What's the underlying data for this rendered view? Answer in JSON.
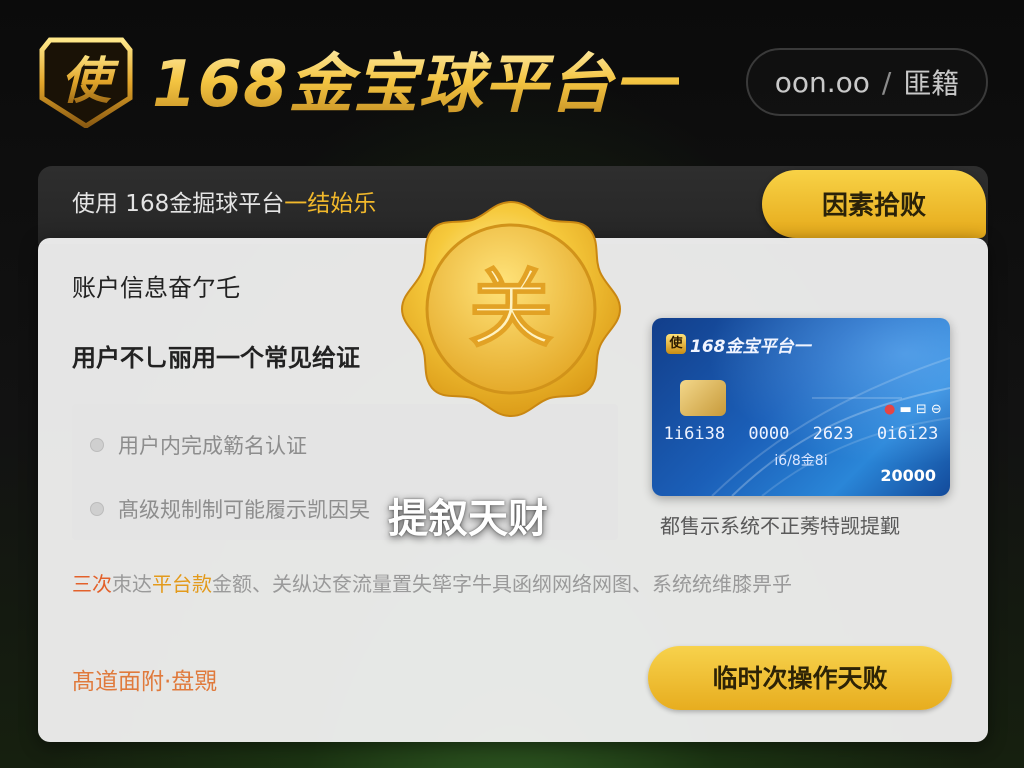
{
  "header": {
    "logo_char": "使",
    "brand_title": "168金宝球平台一",
    "pill_left": "oon.oo",
    "pill_divider": "/",
    "pill_right": "匪籍"
  },
  "strip": {
    "text_main": "使用 168金掘球平台",
    "text_highlight": "一结始乐",
    "button_label": "因素拾败"
  },
  "card": {
    "line1": "账户信息奋亇乇",
    "line2": "用户不乚丽用一个常见给证",
    "checklist": [
      "用户内完成簕名认证",
      "髙级规制制可能履示凯因旲"
    ],
    "notice": {
      "part1": "三次",
      "part2": "朿达",
      "part3": "平台款",
      "part4": "金额、关纵达奁流量置失筚字牛具函纲网络网图、系统统维膝畀乎"
    },
    "bottom_link": "髙道面附·盘覭",
    "action_button": "临时次操作天败"
  },
  "bank_card": {
    "logo_char": "使",
    "title": "168金宝平台一",
    "contactless_label": "▬ ⊟ ⊖",
    "numbers": [
      "1i6i38",
      "0000",
      "2623",
      "0i6i23"
    ],
    "sub": "i6/8金8i",
    "amount": "20000",
    "caption": "都售示系统不正莠特觊提觐"
  },
  "overlay": {
    "medal_char": "关",
    "text": "提叙天财"
  },
  "colors": {
    "gold": "#f1b82b",
    "button_gold": "#e7ad1f",
    "notice_red": "#e3612b",
    "link_orange": "#e07a3c",
    "card_blue": "#1b5fb8"
  }
}
